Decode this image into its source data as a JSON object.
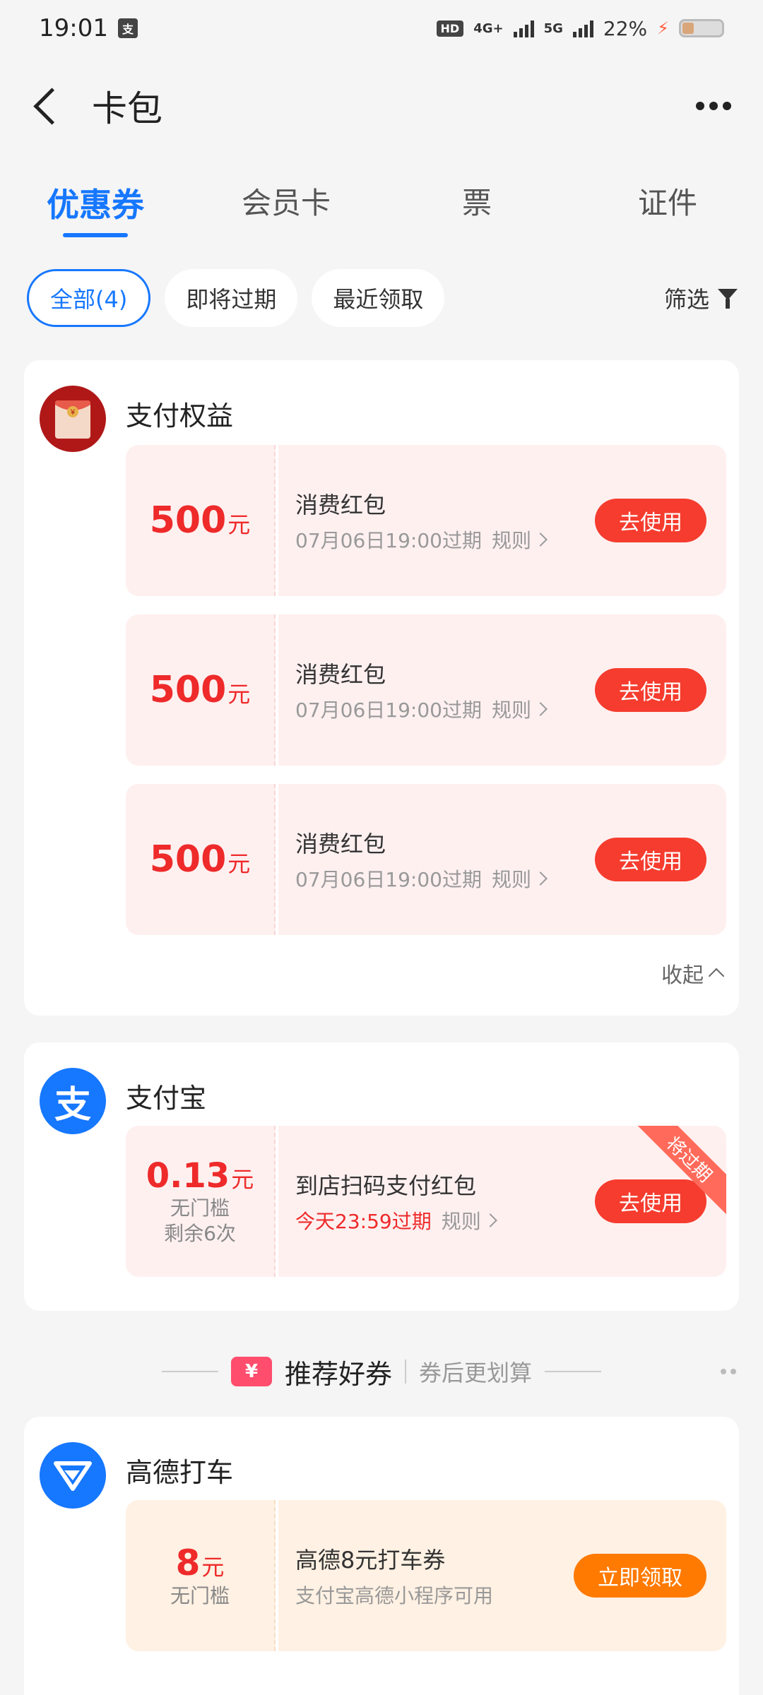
{
  "status_bar": {
    "time": "19:01",
    "app_badge": "支",
    "network_badge": "HD",
    "net_4g": "4G+",
    "net_5g": "5G",
    "battery": "22%"
  },
  "header": {
    "title": "卡包"
  },
  "tabs": [
    {
      "label": "优惠券",
      "active": true
    },
    {
      "label": "会员卡",
      "active": false
    },
    {
      "label": "票",
      "active": false
    },
    {
      "label": "证件",
      "active": false
    }
  ],
  "filters": {
    "chips": [
      "全部(4)",
      "即将过期",
      "最近领取"
    ],
    "filter_label": "筛选"
  },
  "section_payment": {
    "name": "支付权益",
    "coupons": [
      {
        "amount": "500",
        "unit": "元",
        "title": "消费红包",
        "expiry": "07月06日19:00过期",
        "rule": "规则",
        "action": "去使用"
      },
      {
        "amount": "500",
        "unit": "元",
        "title": "消费红包",
        "expiry": "07月06日19:00过期",
        "rule": "规则",
        "action": "去使用"
      },
      {
        "amount": "500",
        "unit": "元",
        "title": "消费红包",
        "expiry": "07月06日19:00过期",
        "rule": "规则",
        "action": "去使用"
      }
    ],
    "collapse_label": "收起"
  },
  "section_alipay": {
    "name": "支付宝",
    "logo_char": "支",
    "coupon": {
      "amount": "0.13",
      "unit": "元",
      "note1": "无门槛",
      "note2": "剩余6次",
      "title": "到店扫码支付红包",
      "expiry": "今天23:59过期",
      "rule": "规则",
      "action": "去使用",
      "ribbon": "将过期"
    }
  },
  "recommend": {
    "icon_char": "¥",
    "title": "推荐好券",
    "subtitle": "券后更划算"
  },
  "section_amap": {
    "name": "高德打车",
    "coupon": {
      "amount": "8",
      "unit": "元",
      "note1": "无门槛",
      "title": "高德8元打车券",
      "desc": "支付宝高德小程序可用",
      "action": "立即领取"
    }
  },
  "colors": {
    "accent": "#1677ff",
    "coupon_red": "#ee2a2a",
    "use_button": "#f53c2e",
    "claim_button": "#ff7a00"
  }
}
